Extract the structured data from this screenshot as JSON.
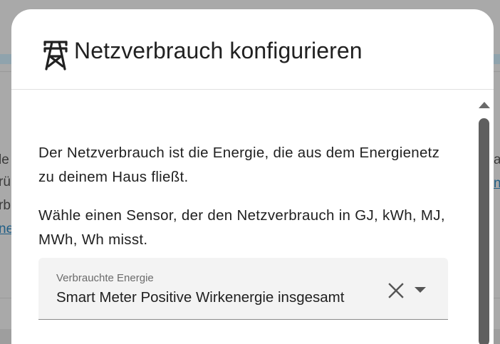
{
  "background": {
    "fragments": [
      "le",
      "rü",
      "rb",
      "ne"
    ],
    "right_fragments": [
      "a",
      "n"
    ]
  },
  "dialog": {
    "title": "Netzverbrauch konfigurieren",
    "title_icon": "transmission-tower-icon",
    "paragraph_1": "Der Netzverbrauch ist die Energie, die aus dem Energienetz zu deinem Haus fließt.",
    "paragraph_2": "Wähle einen Sensor, der den Netzverbrauch in GJ, kWh, MJ, MWh, Wh misst.",
    "sensor_field": {
      "label": "Verbrauchte Energie",
      "value": "Smart Meter Positive Wirkenergie insgesamt",
      "clear_icon": "close-icon",
      "dropdown_icon": "caret-down-icon"
    }
  },
  "colors": {
    "overlay": "#a9a9a9",
    "dialog_bg": "#ffffff",
    "field_bg": "#f3f3f3",
    "text": "#212121",
    "label": "#6b6b6b",
    "scrollbar": "#5f5f5f",
    "link": "#1f5e86"
  }
}
